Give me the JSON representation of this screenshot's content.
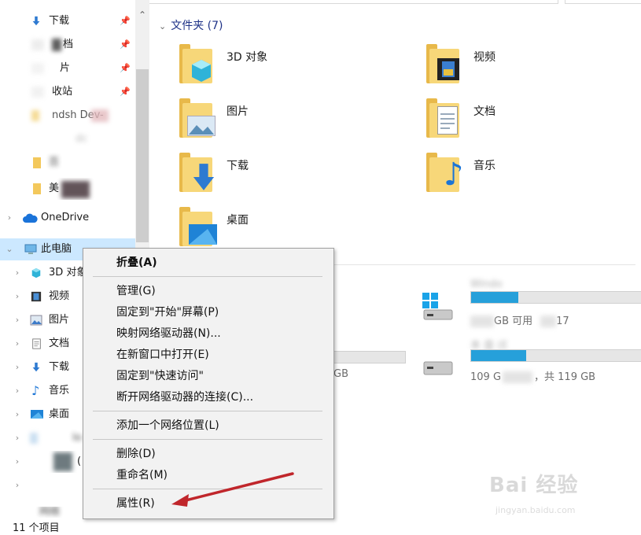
{
  "nav": {
    "quick_items": [
      {
        "label": "下载",
        "pinned": true
      },
      {
        "label": "档",
        "pinned": true
      },
      {
        "label": "片",
        "pinned": true
      },
      {
        "label": "收站",
        "pinned": true
      },
      {
        "label": "ndsh  Dev-",
        "pinned": false
      },
      {
        "label": "dc",
        "pinned": false
      },
      {
        "label": "百",
        "pinned": false
      },
      {
        "label": "美",
        "pinned": false
      }
    ],
    "onedrive": "OneDrive",
    "this_pc": "此电脑",
    "pc_children": [
      "3D 对象",
      "视频",
      "图片",
      "文档",
      "下载",
      "音乐",
      "桌面",
      "lo",
      "(",
      "",
      "网络"
    ]
  },
  "status": {
    "count": "11 个项目"
  },
  "main": {
    "folders_header": "文件夹 (7)",
    "folders": [
      "3D 对象",
      "视频",
      "图片",
      "文档",
      "下载",
      "音乐",
      "桌面"
    ],
    "drives": [
      {
        "name": "Windo",
        "free": "GB 可用",
        "total": "17"
      },
      {
        "name": "本 盘 (E",
        "free": "109 G",
        "total": "，共 119 GB"
      }
    ],
    "drive_left_total": "GB"
  },
  "context_menu": {
    "items": [
      "折叠(A)",
      "管理(G)",
      "固定到\"开始\"屏幕(P)",
      "映射网络驱动器(N)...",
      "在新窗口中打开(E)",
      "固定到\"快速访问\"",
      "断开网络驱动器的连接(C)...",
      "添加一个网络位置(L)",
      "删除(D)",
      "重命名(M)",
      "属性(R)"
    ]
  },
  "watermark": {
    "logo": "Bai  经验",
    "url": "jingyan.baidu.com"
  },
  "colors": {
    "arrow": "#c0262b",
    "selection": "#cce8ff",
    "header": "#1e3287"
  }
}
